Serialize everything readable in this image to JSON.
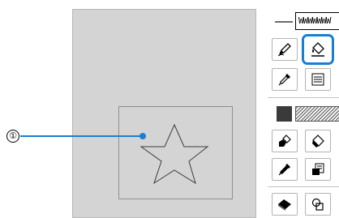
{
  "callout": {
    "number": "①"
  },
  "line_property": {
    "stitch_preview": "WWWWWWW"
  },
  "tools": [
    {
      "name": "pen-tool",
      "icon": "pen-icon"
    },
    {
      "name": "line-eraser-tool",
      "icon": "eraser-fill-icon",
      "selected": true
    },
    {
      "name": "line-eyedropper-tool",
      "icon": "eyedropper-icon"
    },
    {
      "name": "line-property-tool",
      "icon": "lines-icon"
    },
    {
      "name": "fill-brush-tool",
      "icon": "paint-brush-icon"
    },
    {
      "name": "fill-bucket-tool",
      "icon": "paint-bucket-icon"
    },
    {
      "name": "region-eyedropper-tool",
      "icon": "eyedropper-icon"
    },
    {
      "name": "region-property-tool",
      "icon": "layers-icon"
    },
    {
      "name": "eraser-tool",
      "icon": "eraser-icon"
    },
    {
      "name": "select-tool",
      "icon": "select-icon"
    }
  ],
  "colors": {
    "accent": "#1a7fd1",
    "canvas": "#d4d4d4",
    "fill_swatch": "#3a3a3a"
  }
}
